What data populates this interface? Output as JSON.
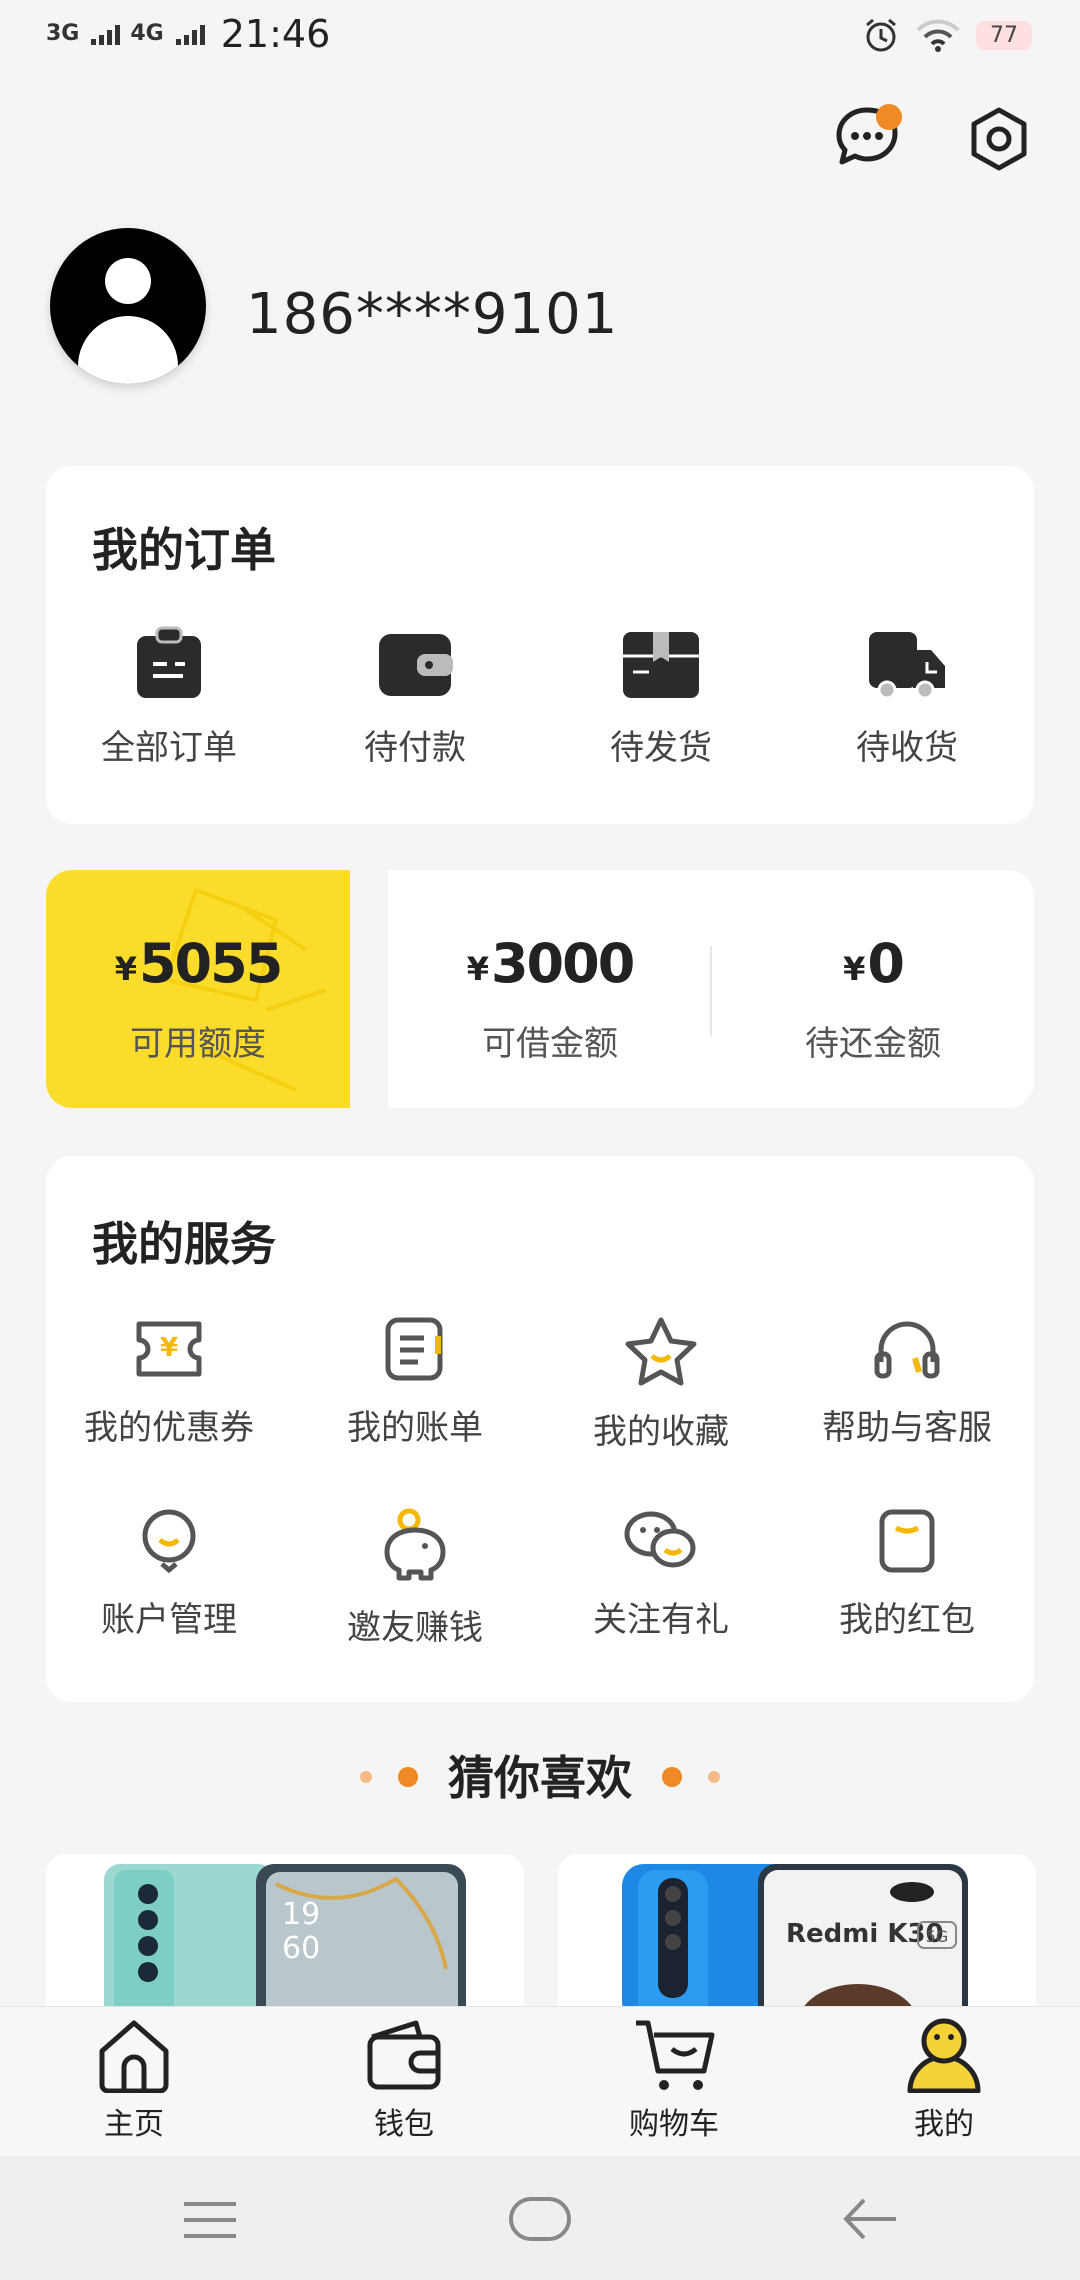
{
  "status_bar": {
    "network1": "3G",
    "network2": "4G",
    "time": "21:46",
    "battery": "77"
  },
  "header": {
    "message_icon": "chat-bubble-icon",
    "settings_icon": "hexagon-gear-icon",
    "notification_dot_color": "#f08a24"
  },
  "profile": {
    "phone": "186****9101"
  },
  "orders": {
    "title": "我的订单",
    "items": [
      {
        "label": "全部订单",
        "icon": "clipboard-icon"
      },
      {
        "label": "待付款",
        "icon": "wallet-icon"
      },
      {
        "label": "待发货",
        "icon": "package-icon"
      },
      {
        "label": "待收货",
        "icon": "truck-icon"
      }
    ]
  },
  "credit": {
    "available": {
      "currency": "¥",
      "value": "5055",
      "label": "可用额度"
    },
    "borrowable": {
      "currency": "¥",
      "value": "3000",
      "label": "可借金额"
    },
    "repay": {
      "currency": "¥",
      "value": "0",
      "label": "待还金额"
    },
    "accent_color": "#fcdc2b"
  },
  "services": {
    "title": "我的服务",
    "items": [
      {
        "label": "我的优惠券",
        "icon": "coupon-icon"
      },
      {
        "label": "我的账单",
        "icon": "bill-icon"
      },
      {
        "label": "我的收藏",
        "icon": "star-icon"
      },
      {
        "label": "帮助与客服",
        "icon": "headset-icon"
      },
      {
        "label": "账户管理",
        "icon": "user-face-icon"
      },
      {
        "label": "邀友赚钱",
        "icon": "piggy-bank-icon"
      },
      {
        "label": "关注有礼",
        "icon": "wechat-icon"
      },
      {
        "label": "我的红包",
        "icon": "red-envelope-icon"
      }
    ]
  },
  "recommend": {
    "title": "猜你喜欢",
    "product2_text": "Redmi K30",
    "product2_badge": "5G",
    "product1_screen_text": "19\n60"
  },
  "tabbar": {
    "items": [
      {
        "label": "主页",
        "icon": "home-icon"
      },
      {
        "label": "钱包",
        "icon": "wallet-icon"
      },
      {
        "label": "购物车",
        "icon": "cart-icon"
      },
      {
        "label": "我的",
        "icon": "profile-icon",
        "active": true
      }
    ]
  },
  "system_nav": {
    "menu_icon": "menu-icon",
    "home_icon": "home-pill-icon",
    "back_icon": "back-arrow-icon"
  }
}
